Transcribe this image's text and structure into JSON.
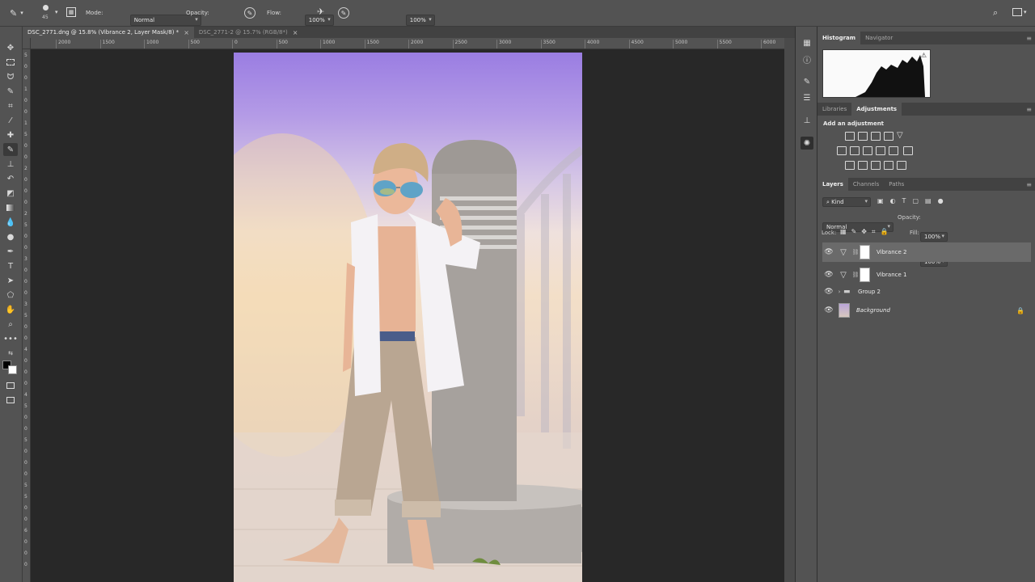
{
  "options_bar": {
    "brush_size": "45",
    "mode_label": "Mode:",
    "mode_value": "Normal",
    "opacity_label": "Opacity:",
    "opacity_value": "100%",
    "flow_label": "Flow:",
    "flow_value": "100%"
  },
  "tabs": [
    {
      "label": "DSC_2771.dng @ 15.8% (Vibrance 2, Layer Mask/8) *",
      "close": "×"
    },
    {
      "label": "DSC_2771-2 @ 15.7% (RGB/8*)",
      "close": "×"
    }
  ],
  "ruler": {
    "top": [
      "2000",
      "1500",
      "1000",
      "500",
      "0",
      "500",
      "1000",
      "1500",
      "2000",
      "2500",
      "3000",
      "3500",
      "4000",
      "4500",
      "5000",
      "5500",
      "6000"
    ],
    "left": [
      "5",
      "0",
      "0",
      "1",
      "0",
      "0",
      "1",
      "5",
      "0",
      "0",
      "2",
      "0",
      "0",
      "0",
      "2",
      "5",
      "0",
      "0",
      "3",
      "0",
      "0",
      "0",
      "3",
      "5",
      "0",
      "0",
      "4",
      "0",
      "0",
      "0",
      "4",
      "5",
      "0",
      "0",
      "5",
      "0",
      "0",
      "0",
      "5",
      "5",
      "0",
      "0",
      "6",
      "0",
      "0",
      "0"
    ]
  },
  "panels": {
    "top_tabs": [
      "Histogram",
      "Navigator"
    ],
    "mid_tabs": [
      "Libraries",
      "Adjustments"
    ],
    "adjustments_title": "Add an adjustment",
    "layer_tabs": [
      "Layers",
      "Channels",
      "Paths"
    ],
    "kind_label": "Kind",
    "blend_mode": "Normal",
    "opacity_label": "Opacity:",
    "opacity_value": "100%",
    "lock_label": "Lock:",
    "fill_label": "Fill:",
    "fill_value": "100%",
    "layers": [
      {
        "name": "Vibrance 2",
        "selected": true
      },
      {
        "name": "Vibrance 1",
        "selected": false
      },
      {
        "name": "Group 2",
        "selected": false
      },
      {
        "name": "Background",
        "selected": false
      }
    ]
  },
  "colors": {
    "panel_bg": "#535353",
    "canvas_bg": "#282828",
    "selected_layer": "#6a6a6a"
  }
}
